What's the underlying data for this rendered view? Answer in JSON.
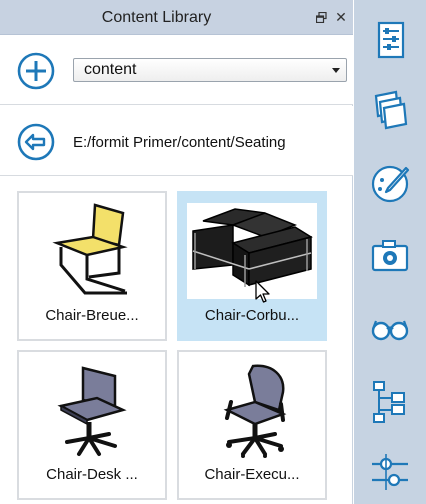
{
  "panel": {
    "title": "Content Library",
    "close_glyph": "✕"
  },
  "toolbar": {
    "add_icon": "plus-circle-icon",
    "location_value": "content"
  },
  "pathbar": {
    "back_icon": "back-arrow-icon",
    "path": "E:/formit Primer/content/Seating"
  },
  "items": [
    {
      "label": "Chair-Breue...",
      "selected": false
    },
    {
      "label": "Chair-Corbu...",
      "selected": true
    },
    {
      "label": "Chair-Desk ...",
      "selected": false
    },
    {
      "label": "Chair-Execu...",
      "selected": false
    }
  ],
  "side_toolbar": [
    {
      "icon": "properties-list-icon"
    },
    {
      "icon": "materials-layers-icon"
    },
    {
      "icon": "paint-brush-icon"
    },
    {
      "icon": "camera-icon"
    },
    {
      "icon": "glasses-icon"
    },
    {
      "icon": "hierarchy-tree-icon"
    },
    {
      "icon": "adjust-sliders-icon"
    }
  ],
  "colors": {
    "accent": "#1e78b8",
    "title_bg": "#c7d2e1",
    "side_bg": "#c6d3e2",
    "selected_bg": "#c6e3f5"
  }
}
